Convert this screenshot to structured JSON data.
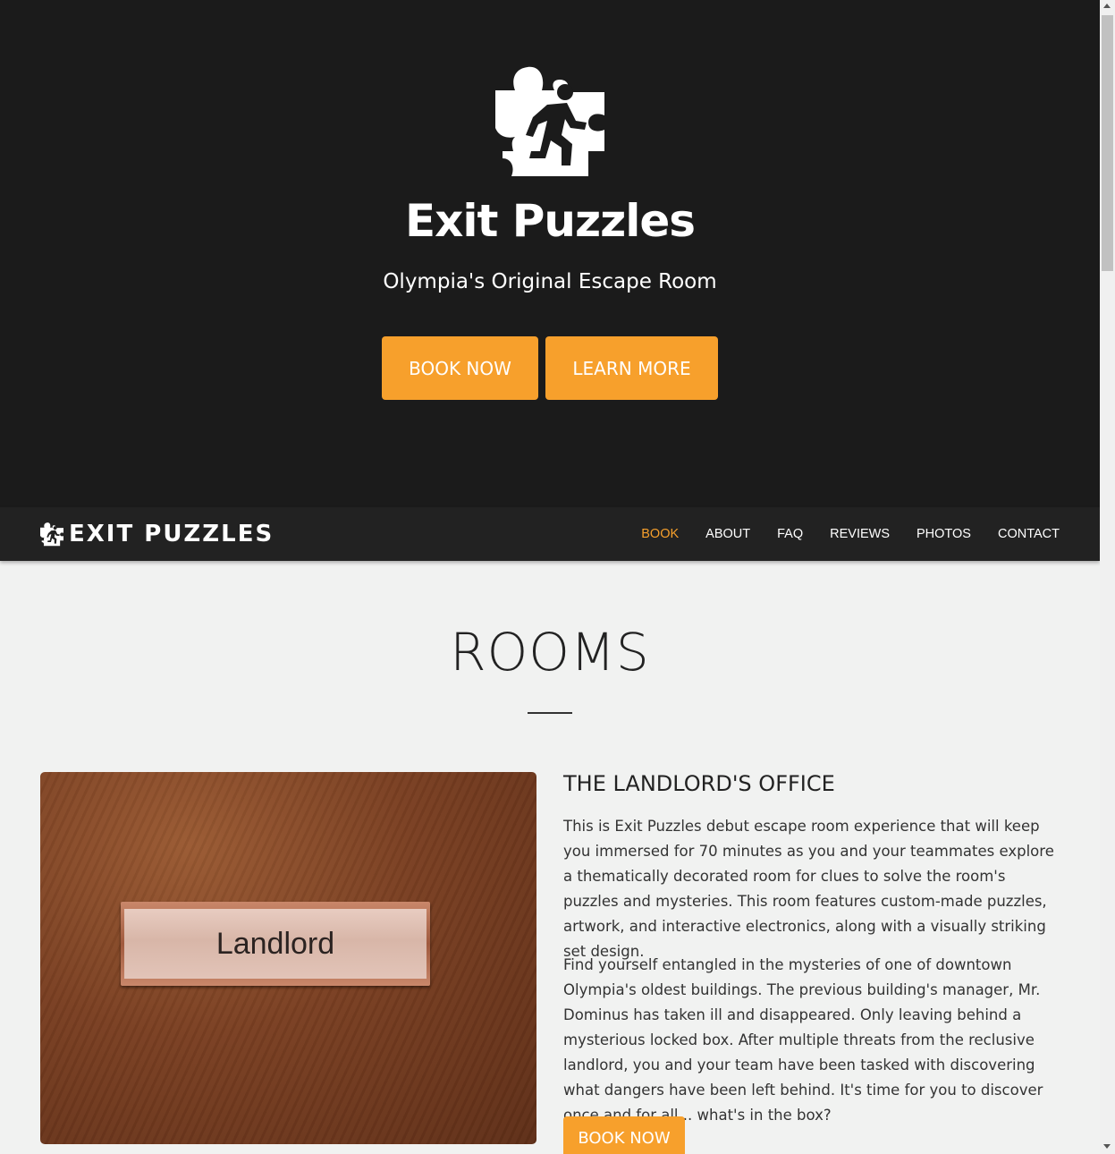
{
  "hero": {
    "logo_icon": "puzzle-escape-runner-icon",
    "title": "Exit Puzzles",
    "subtitle": "Olympia's Original Escape Room",
    "book_label": "BOOK NOW",
    "learn_label": "LEARN MORE"
  },
  "nav": {
    "brand_icon": "puzzle-escape-runner-icon",
    "brand": "EXIT PUZZLES",
    "links": [
      {
        "label": "BOOK",
        "active": true
      },
      {
        "label": "ABOUT",
        "active": false
      },
      {
        "label": "FAQ",
        "active": false
      },
      {
        "label": "REVIEWS",
        "active": false
      },
      {
        "label": "PHOTOS",
        "active": false
      },
      {
        "label": "CONTACT",
        "active": false
      }
    ]
  },
  "rooms": {
    "title": "ROOMS",
    "room": {
      "image_plate_text": "Landlord",
      "name": "THE LANDLORD'S OFFICE",
      "paragraphs": [
        "This is Exit Puzzles debut escape room experience that will keep you immersed for 70 minutes as you and your teammates explore a thematically decorated room for clues to solve the room's puzzles and mysteries. This room features custom-made puzzles, artwork, and interactive electronics, along with a visually striking set design.",
        "Find yourself entangled in the mysteries of one of downtown Olympia's oldest buildings. The previous building's manager, Mr. Dominus has taken ill and disappeared. Only leaving behind a mysterious locked box. After multiple threats from the reclusive landlord, you and your team have been tasked with discovering what dangers have been left behind. It's time for you to discover once and for all... what's in the box?"
      ],
      "book_label": "BOOK NOW"
    }
  },
  "colors": {
    "hero_bg": "#1b1b1b",
    "nav_bg": "#222222",
    "accent": "#f7a02c",
    "page_bg": "#f1f2f1"
  }
}
